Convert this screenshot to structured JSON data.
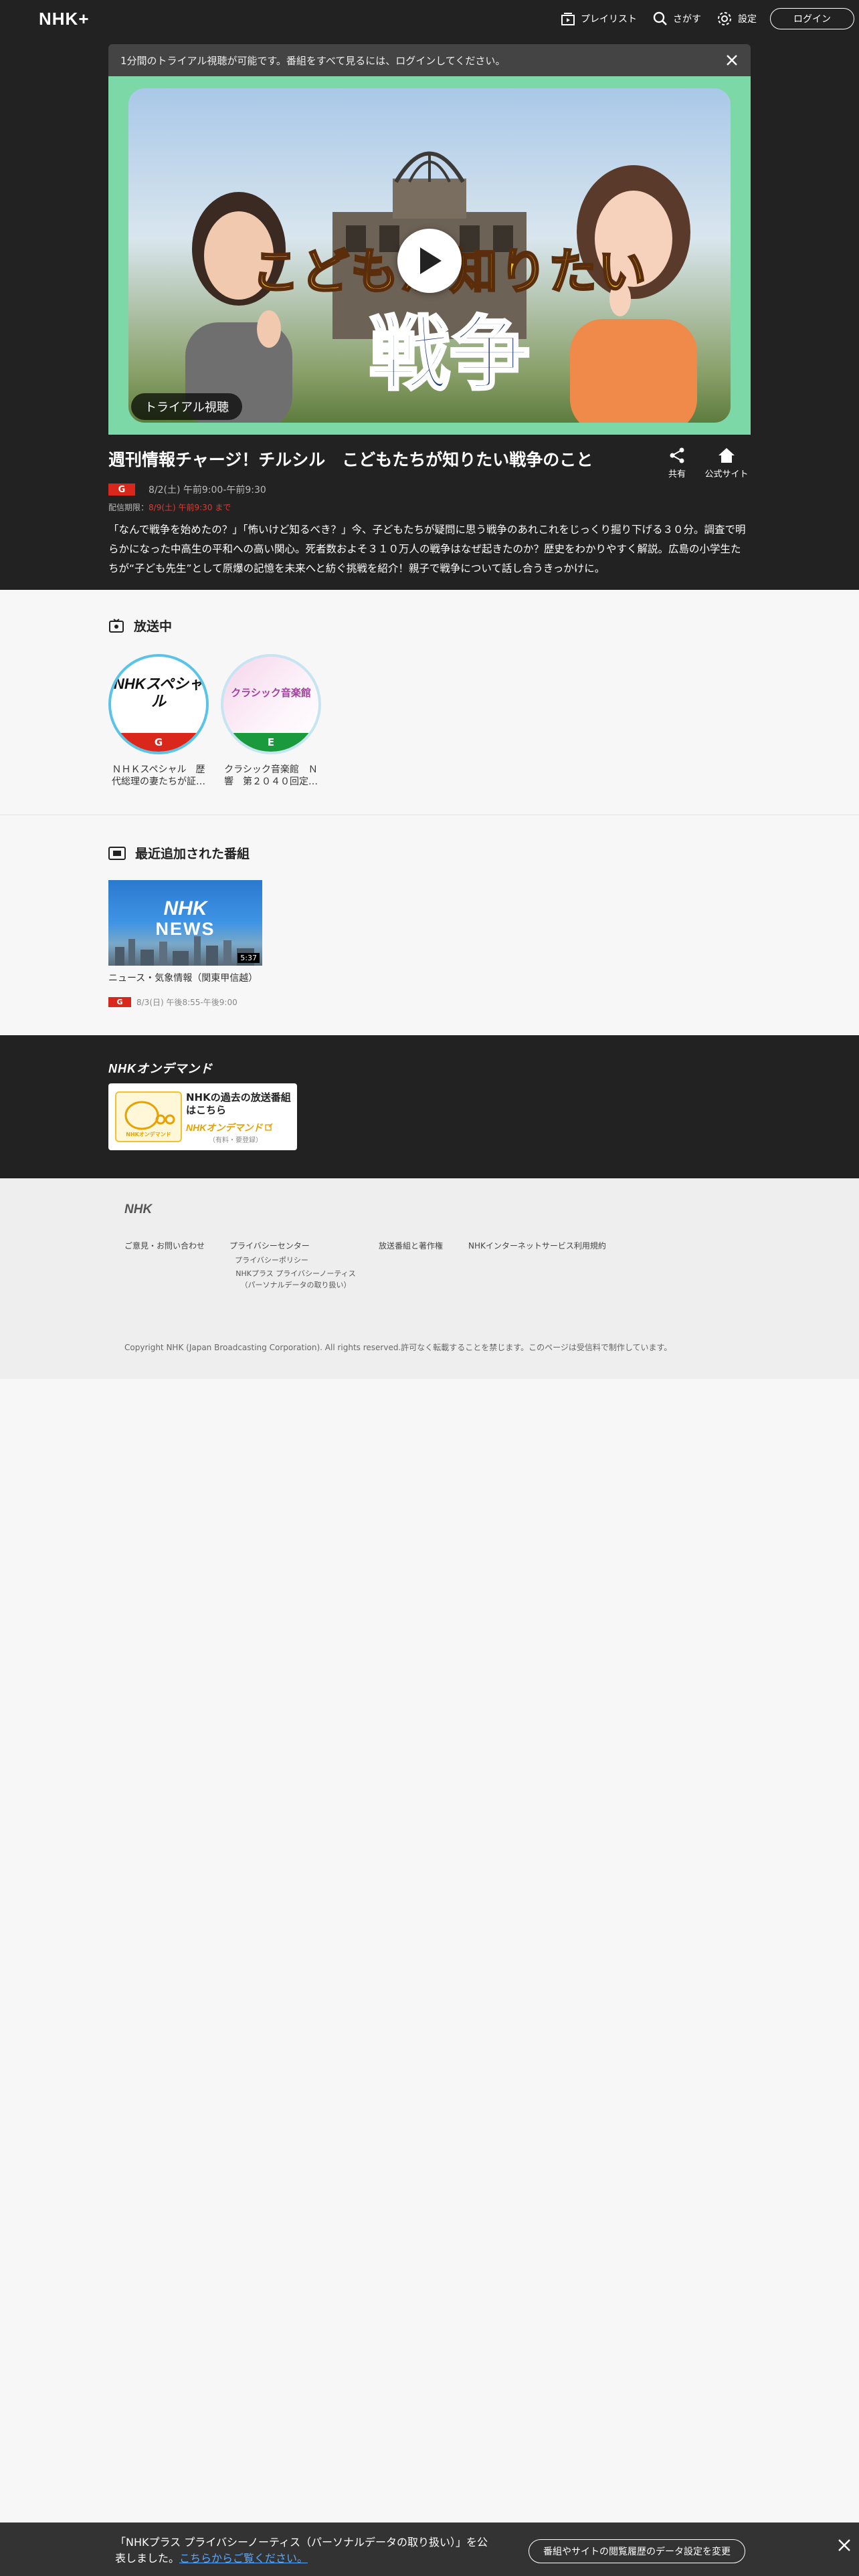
{
  "header": {
    "logo": "NHK+",
    "playlist_label": "プレイリスト",
    "search_label": "さがす",
    "settings_label": "設定",
    "login_label": "ログイン"
  },
  "notice": {
    "text": "1分間のトライアル視聴が可能です。番組をすべて見るには、ログインしてください。"
  },
  "hero": {
    "art_text_1": "こどもが知りたい",
    "art_text_2": "戦争",
    "trial_label": "トライアル視聴"
  },
  "program": {
    "title": "週刊情報チャージ！チルシル　こどもたちが知りたい戦争のこと",
    "share_label": "共有",
    "site_label": "公式サイト",
    "channel": "G",
    "airtime": "8/2(土) 午前9:00-午前9:30",
    "deadline_prefix": "配信期限：",
    "deadline": "8/9(土) 午前9:30 まで",
    "description": "「なんで戦争を始めたの？」「怖いけど知るべき？」今、子どもたちが疑問に思う戦争のあれこれをじっくり掘り下げる３０分。調査で明らかになった中高生の平和への高い関心。死者数およそ３１０万人の戦争はなぜ起きたのか？歴史をわかりやすく解説。広島の小学生たちが“子ども先生”として原爆の記憶を未来へと紡ぐ挑戦を紹介！親子で戦争について話し合うきっかけに。"
  },
  "on_air": {
    "title": "放送中",
    "channels": [
      {
        "logo": "NHKスペシャル",
        "badge": "G",
        "name": "ＮＨＫスペシャル　歴代総理の妻たちが証…",
        "color": "#d9271c"
      },
      {
        "logo": "クラシック音楽館",
        "badge": "E",
        "name": "クラシック音楽館　Ｎ響　第２０４０回定…",
        "color": "#1a9a3c"
      }
    ]
  },
  "recent": {
    "title": "最近追加された番組",
    "items": [
      {
        "thumb_line1": "NHK",
        "thumb_line2": "NEWS",
        "duration": "5:37",
        "name": "ニュース・気象情報（関東甲信越）",
        "channel": "G",
        "airtime": "8/3(日) 午後8:55-午後9:00"
      }
    ]
  },
  "ondemand": {
    "logo": "NHKオンデマンド",
    "banner_text": "NHKの過去の放送番組はこちら",
    "banner_brand": "NHKオンデマンド",
    "banner_note": "（有料・要登録）",
    "char_label": "NHKオンデマンド"
  },
  "footer": {
    "logo": "NHK",
    "links": {
      "contact": "ご意見・お問い合わせ",
      "privacy_center": "プライバシーセンター",
      "privacy_policy": "プライバシーポリシー",
      "privacy_notice": "NHKプラス プライバシーノーティス（パーソナルデータの取り扱い）",
      "copyright_link": "放送番組と著作権",
      "terms": "NHKインターネットサービス利用規約"
    },
    "copyright": "Copyright NHK (Japan Broadcasting Corporation). All rights reserved.許可なく転載することを禁じます。このページは受信料で制作しています。"
  },
  "cookie": {
    "text": "「NHKプラス プライバシーノーティス（パーソナルデータの取り扱い）」を公表しました。",
    "link": "こちらからご覧ください。",
    "button": "番組やサイトの閲覧履歴のデータ設定を変更"
  }
}
